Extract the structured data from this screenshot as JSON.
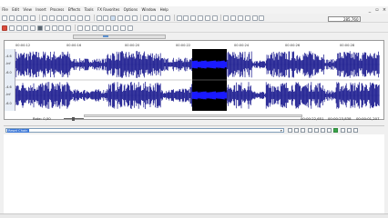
{
  "menu": {
    "items": [
      "File",
      "Edit",
      "View",
      "Insert",
      "Process",
      "Effects",
      "Tools",
      "FX Favorites",
      "Options",
      "Window",
      "Help"
    ]
  },
  "toolbar": {
    "zoom_value": "285,760"
  },
  "data_window": {
    "ruler_labels": [
      "00:00:12",
      "00:00:16",
      "00:00:20",
      "00:00:22",
      "00:00:24",
      "00:00:26",
      "00:00:28"
    ],
    "db_labels_top": [
      "-4.6",
      "-Inf",
      "-6.0"
    ],
    "db_labels_bottom": [
      "-4.6",
      "-Inf",
      "-6.0"
    ],
    "rate_text": "Rate: 0,00"
  },
  "selection": {
    "start": "00:00:22,651",
    "end": "00:00:23,838",
    "length": "00:00:01,207"
  },
  "bottom_bar": {
    "preset_selected": "Reset Chain"
  },
  "colors": {
    "waveform": "#14148c",
    "selection_bg": "#000000",
    "selection_wave": "#1a1aff",
    "accent": "#3875d7"
  }
}
